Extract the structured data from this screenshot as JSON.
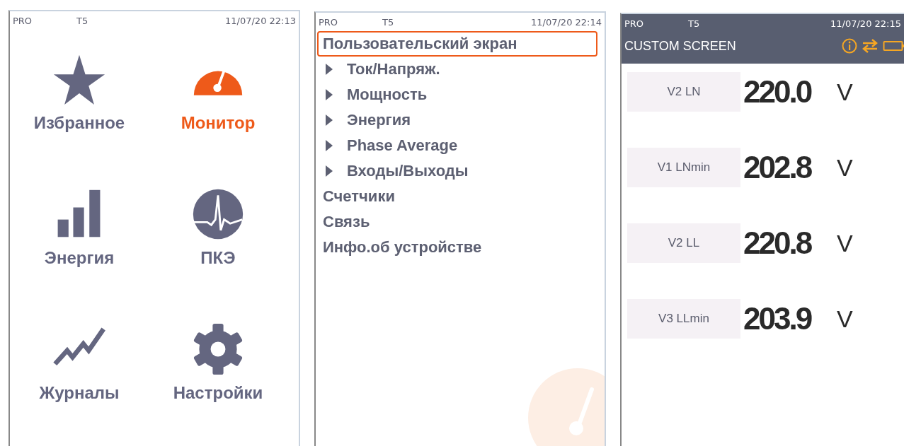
{
  "home": {
    "status": {
      "mode": "PRO",
      "device": "T5",
      "datetime": "11/07/20 22:13"
    },
    "tiles": [
      {
        "label": "Избранное",
        "selected": false
      },
      {
        "label": "Монитор",
        "selected": true
      },
      {
        "label": "Энергия",
        "selected": false
      },
      {
        "label": "ПКЭ",
        "selected": false
      },
      {
        "label": "Журналы",
        "selected": false
      },
      {
        "label": "Настройки",
        "selected": false
      }
    ]
  },
  "menu": {
    "status": {
      "mode": "PRO",
      "device": "T5",
      "datetime": "11/07/20 22:14"
    },
    "items": [
      {
        "label": "Пользовательский экран",
        "selected": true,
        "expandable": false
      },
      {
        "label": "Ток/Напряж.",
        "selected": false,
        "expandable": true
      },
      {
        "label": "Мощность",
        "selected": false,
        "expandable": true
      },
      {
        "label": "Энергия",
        "selected": false,
        "expandable": true
      },
      {
        "label": "Phase Average",
        "selected": false,
        "expandable": true
      },
      {
        "label": "Входы/Выходы",
        "selected": false,
        "expandable": true
      },
      {
        "label": "Счетчики",
        "selected": false,
        "expandable": false
      },
      {
        "label": "Связь",
        "selected": false,
        "expandable": false
      },
      {
        "label": "Инфо.об устройстве",
        "selected": false,
        "expandable": false
      }
    ]
  },
  "custom": {
    "status": {
      "mode": "PRO",
      "device": "T5",
      "datetime": "11/07/20 22:15"
    },
    "title": "CUSTOM SCREEN",
    "rows": [
      {
        "label": "V2 LN",
        "value": "220.0",
        "unit": "V"
      },
      {
        "label": "V1 LNmin",
        "value": "202.8",
        "unit": "V"
      },
      {
        "label": "V2 LL",
        "value": "220.8",
        "unit": "V"
      },
      {
        "label": "V3 LLmin",
        "value": "203.9",
        "unit": "V"
      }
    ]
  }
}
